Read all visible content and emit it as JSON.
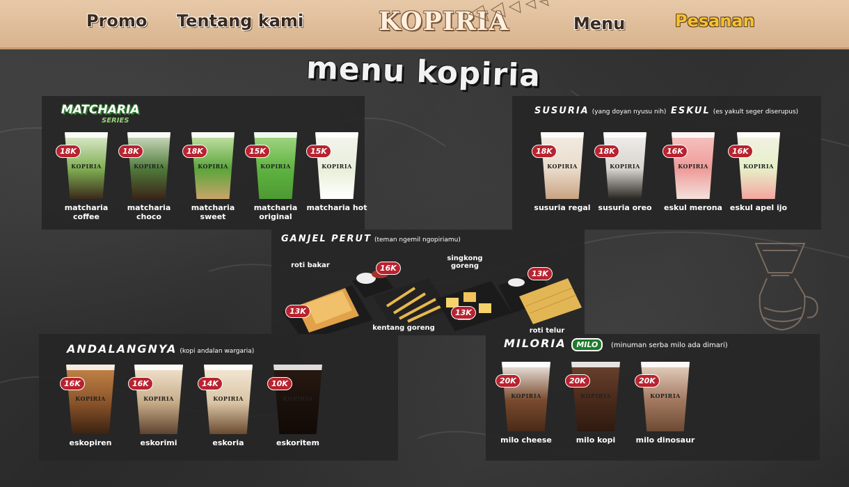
{
  "nav": {
    "links": [
      "Promo",
      "Tentang kami",
      "Menu",
      "Pesanan"
    ],
    "logo": "KOPIRIA"
  },
  "page_title": "menu kopiria",
  "cup_brand": "KOPIRIA",
  "sections": {
    "matcharia": {
      "logo_main": "MATCHARIA",
      "logo_sub": "SERIES",
      "items": [
        {
          "name": "matcharia coffee",
          "price": "18K",
          "colors": [
            "#e6efd9",
            "#7fae52",
            "#3c2a1c"
          ]
        },
        {
          "name": "matcharia choco",
          "price": "18K",
          "colors": [
            "#d8e4cc",
            "#4f7a3a",
            "#3b2418"
          ]
        },
        {
          "name": "matcharia sweet",
          "price": "18K",
          "colors": [
            "#cfe6b0",
            "#5aa53a",
            "#c9a46a"
          ]
        },
        {
          "name": "matcharia original",
          "price": "15K",
          "colors": [
            "#a8d98c",
            "#5fb340",
            "#4d9a33"
          ]
        },
        {
          "name": "matcharia hot",
          "price": "15K",
          "colors": [
            "#f4f4f0",
            "#e8efd9",
            "#ffffff"
          ]
        }
      ]
    },
    "susuria": {
      "title": "SUSURIA",
      "subtitle": "(yang doyan nyusu nih)",
      "items": [
        {
          "name": "susuria regal",
          "price": "18K",
          "colors": [
            "#f3ece3",
            "#e9dccb",
            "#c9a383"
          ]
        },
        {
          "name": "susuria oreo",
          "price": "18K",
          "colors": [
            "#f1efec",
            "#d8d4cf",
            "#2a2622"
          ]
        }
      ]
    },
    "eskul": {
      "title": "ESKUL",
      "subtitle": "(es yakult seger diserupus)",
      "items": [
        {
          "name": "eskul merona",
          "price": "16K",
          "colors": [
            "#f6c6c3",
            "#ee9b98",
            "#f4e1dc"
          ]
        },
        {
          "name": "eskul apel ijo",
          "price": "16K",
          "colors": [
            "#f3f1e4",
            "#e6efc8",
            "#f5a6a0"
          ]
        }
      ]
    },
    "ganjel": {
      "title": "GANJEL PERUT",
      "subtitle": "(teman ngemil ngopiriamu)",
      "items": [
        {
          "name": "roti bakar",
          "price": "13K"
        },
        {
          "name": "kentang goreng",
          "price": "16K"
        },
        {
          "name": "singkong goreng",
          "price": "13K"
        },
        {
          "name": "roti telur",
          "price": "13K"
        }
      ]
    },
    "andalangnya": {
      "title": "ANDALANGNYA",
      "subtitle": "(kopi andalan wargaria)",
      "items": [
        {
          "name": "eskopiren",
          "price": "16K",
          "colors": [
            "#c8874a",
            "#8a5429",
            "#3b2212"
          ]
        },
        {
          "name": "eskorimi",
          "price": "16K",
          "colors": [
            "#f3e7d3",
            "#c7ab88",
            "#5d4330"
          ]
        },
        {
          "name": "eskoria",
          "price": "14K",
          "colors": [
            "#f5ead8",
            "#d9c4a4",
            "#6a4a30"
          ]
        },
        {
          "name": "eskoritem",
          "price": "10K",
          "colors": [
            "#2a1a12",
            "#1a100b",
            "#120a06"
          ]
        }
      ]
    },
    "miloria": {
      "title": "MILORIA",
      "badge": "MILO",
      "subtitle": "(minuman serba milo ada dimari)",
      "items": [
        {
          "name": "milo cheese",
          "price": "20K",
          "colors": [
            "#f4f1ec",
            "#7a4b2f",
            "#4a2a18"
          ]
        },
        {
          "name": "milo kopi",
          "price": "20K",
          "colors": [
            "#6b4330",
            "#4a2a1a",
            "#2e1a10"
          ]
        },
        {
          "name": "milo dinosaur",
          "price": "20K",
          "colors": [
            "#e9d6c8",
            "#a37a60",
            "#6e4a34"
          ]
        }
      ]
    }
  }
}
